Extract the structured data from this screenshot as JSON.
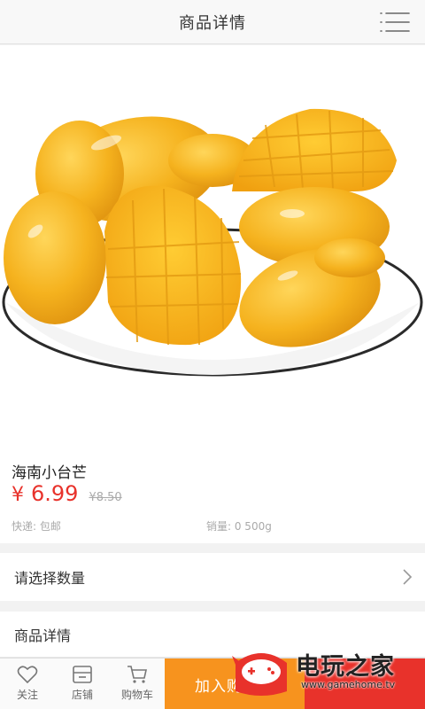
{
  "header": {
    "title": "商品详情",
    "menu_icon": "list-menu-icon"
  },
  "product": {
    "image_subject": "mango-bowl",
    "name": "海南小台芒",
    "price_symbol": "¥",
    "price": "6.99",
    "old_price": "¥8.50",
    "shipping": "快递: 包邮",
    "sales": "销量: 0 500g"
  },
  "quantity": {
    "label": "请选择数量"
  },
  "details": {
    "label": "商品详情"
  },
  "bottom_bar": {
    "tabs": [
      {
        "label": "关注",
        "icon": "heart-icon"
      },
      {
        "label": "店铺",
        "icon": "store-icon"
      },
      {
        "label": "购物车",
        "icon": "cart-icon"
      }
    ],
    "add_to_cart": "加入购物车",
    "buy_now_color": "#e8322b",
    "add_to_cart_color": "#f7931e"
  },
  "watermark": {
    "brand": "电玩之家",
    "url": "www.gamehome.tv"
  },
  "colors": {
    "price": "#e8322b",
    "mango": "#f5b21e"
  }
}
